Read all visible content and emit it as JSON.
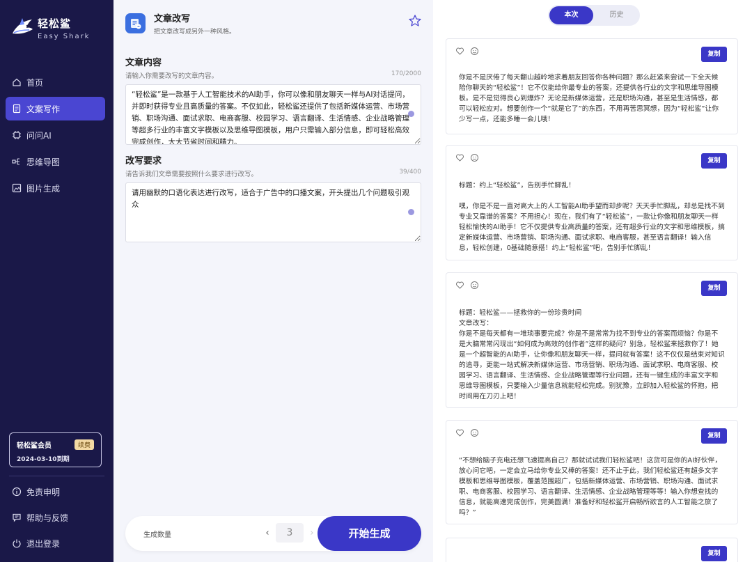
{
  "brand": {
    "name": "轻松鲨",
    "sub": "Easy Shark"
  },
  "nav": [
    {
      "label": "首页",
      "icon": "home-icon",
      "active": false
    },
    {
      "label": "文案写作",
      "icon": "document-icon",
      "active": true
    },
    {
      "label": "问问AI",
      "icon": "ai-chip-icon",
      "active": false
    },
    {
      "label": "思维导图",
      "icon": "mindmap-icon",
      "active": false
    },
    {
      "label": "图片生成",
      "icon": "image-icon",
      "active": false
    }
  ],
  "member": {
    "title": "轻松鲨会员",
    "badge": "续费",
    "expiry": "2024-03-10到期"
  },
  "bottom_nav": [
    {
      "label": "免责申明",
      "icon": "info-icon"
    },
    {
      "label": "帮助与反馈",
      "icon": "feedback-icon"
    },
    {
      "label": "退出登录",
      "icon": "power-icon"
    }
  ],
  "tool": {
    "title": "文章改写",
    "subtitle": "把文章改写成另外一种风格。"
  },
  "content_field": {
    "label": "文章内容",
    "hint": "请输入你需要改写的文章内容。",
    "count": "170/2000",
    "value": "“轻松鲨”是一款基于人工智能技术的AI助手，你可以像和朋友聊天一样与AI对话提问，并即时获得专业且高质量的答案。不仅如此，轻松鲨还提供了包括新媒体运营、市场营销、职场沟通、面试求职、电商客服、校园学习、语言翻译、生活情感、企业战略管理等超多行业的丰富文字模板以及思维导图模板，用户只需输入部分信息，即可轻松高效完成创作，大大节省时间和精力。"
  },
  "requirement_field": {
    "label": "改写要求",
    "hint": "请告诉我们文章需要按照什么要求进行改写。",
    "count": "39/400",
    "value": "请用幽默的口语化表达进行改写，适合于广告中的口播文案，开头提出几个问题吸引观众"
  },
  "generate": {
    "label": "生成数量",
    "value": "3",
    "button": "开始生成"
  },
  "tabs": [
    {
      "label": "本次",
      "active": true
    },
    {
      "label": "历史",
      "active": false
    }
  ],
  "results": {
    "copy_label": "复制",
    "items": [
      {
        "text": "你是不是厌倦了每天翻山越岭地求着朋友回答你各种问题？那么赶紧来尝试一下全天候陪你聊天的“轻松鲨”！它不仅能给你最专业的答案，还提供各行业的文字和思维导图模板。是不是觉得良心到爆炸？无论是新媒体运营，还是职场沟通，甚至是生活情感，都可以轻松应对。想要创作一个“就是它了”的东西，不用再苦思冥想，因为“轻松鲨”让你少写一点，还能多睡一会儿哦！"
      },
      {
        "text": "标题：约上“轻松鲨”，告别手忙脚乱！\n\n嘿，你是不是一直对高大上的人工智能AI助手望而却步呢？天天手忙脚乱，却总是找不到专业又靠谱的答案？不用担心！现在，我们有了“轻松鲨”，一款让你像和朋友聊天一样轻松愉快的AI助手！它不仅提供专业高质量的答案，还有超多行业的文字和思维模板，搞定新媒体运营、市场营销、职场沟通、面试求职、电商客服，甚至语言翻译！输入信息，轻松创建，0基础随意搭！约上“轻松鲨”吧，告别手忙脚乱！"
      },
      {
        "text": "标题：轻松鲨——拯救你的一份珍贵时间\n文章改写：\n你是不是每天都有一堆琐事要完成？你是不是常常为找不到专业的答案而烦恼？你是不是大脑常常闪现出“如何成为高效的创作者”这样的疑问？别急，轻松鲨来拯救你了！她是一个超智能的AI助手，让你像和朋友聊天一样，提问就有答案！这不仅仅是结束对知识的追寻，更能一站式解决新媒体运营、市场营销、职场沟通、面试求职、电商客服、校园学习、语言翻译、生活情感、企业战略管理等行业问题，还有一键生成的丰富文字和思维导图模板，只要输入少量信息就能轻松完成。别犹豫，立即加入轻松鲨的怀抱，把时间用在刀刃上吧！"
      },
      {
        "text": "“不想给脑子充电还想飞速提高自己？那就试试我们轻松鲨吧！这货可是你的AI好伙伴，放心问它吧，一定会立马给你专业又棒的答案！还不止于此，我们轻松鲨还有超多文字模板和思维导图模板，覆盖范围超广，包括新媒体运营、市场营销、职场沟通、面试求职、电商客服、校园学习、语言翻译、生活情感、企业战略管理等等！输入你想查找的信息，就能高速完成创作，完美圆满！准备好和轻松鲨开启畅所欲言的人工智能之旅了吗？”"
      }
    ]
  }
}
